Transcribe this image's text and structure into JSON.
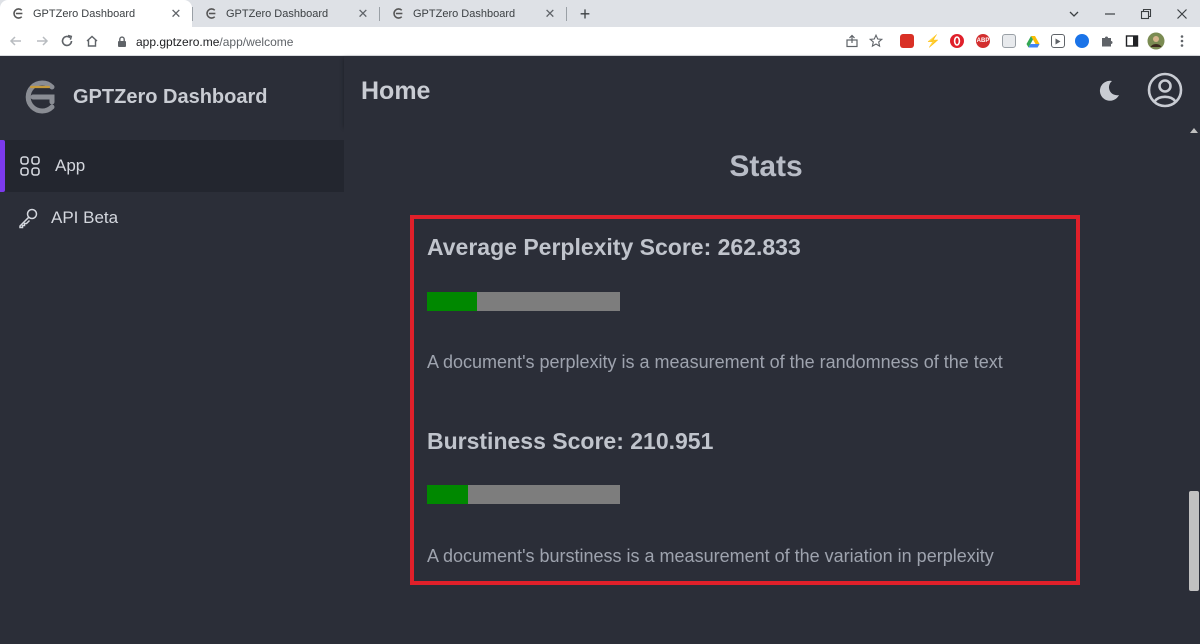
{
  "browser": {
    "tabs": [
      {
        "title": "GPTZero Dashboard",
        "active": true
      },
      {
        "title": "GPTZero Dashboard",
        "active": false
      },
      {
        "title": "GPTZero Dashboard",
        "active": false
      }
    ],
    "new_tab_label": "+",
    "url_host": "app.gptzero.me",
    "url_path": "/app/welcome",
    "extensions": [
      {
        "name": "red-square-extension-icon",
        "color": "#d93025"
      },
      {
        "name": "bolt-extension-icon",
        "color": "#202124"
      },
      {
        "name": "opera-extension-icon",
        "color": "#e0202a"
      },
      {
        "name": "abp-extension-icon",
        "color": "#d32f2f",
        "label": "ABP"
      },
      {
        "name": "document-extension-icon",
        "color": "#9aa0a6"
      },
      {
        "name": "drive-extension-icon",
        "color": "#34a853"
      },
      {
        "name": "media-extension-icon",
        "color": "#5f6368"
      },
      {
        "name": "blue-extension-icon",
        "color": "#1a73e8"
      }
    ]
  },
  "sidebar": {
    "brand": "GPTZero Dashboard",
    "items": [
      {
        "label": "App",
        "icon": "grid-icon",
        "active": true
      },
      {
        "label": "API Beta",
        "icon": "key-icon",
        "active": false
      }
    ]
  },
  "header": {
    "title": "Home"
  },
  "stats": {
    "title": "Stats",
    "perplexity": {
      "heading": "Average Perplexity Score: 262.833",
      "bar_fraction": 0.26,
      "description": "A document's perplexity is a measurement of the randomness of the text"
    },
    "burstiness": {
      "heading": "Burstiness Score: 210.951",
      "bar_fraction": 0.21,
      "description": "A document's burstiness is a measurement of the variation in perplexity"
    }
  },
  "colors": {
    "background": "#2b2e38",
    "accent": "#7c3aed",
    "bar_fill": "#008800",
    "bar_track": "#7d7d7d",
    "highlight": "#e0202a"
  }
}
